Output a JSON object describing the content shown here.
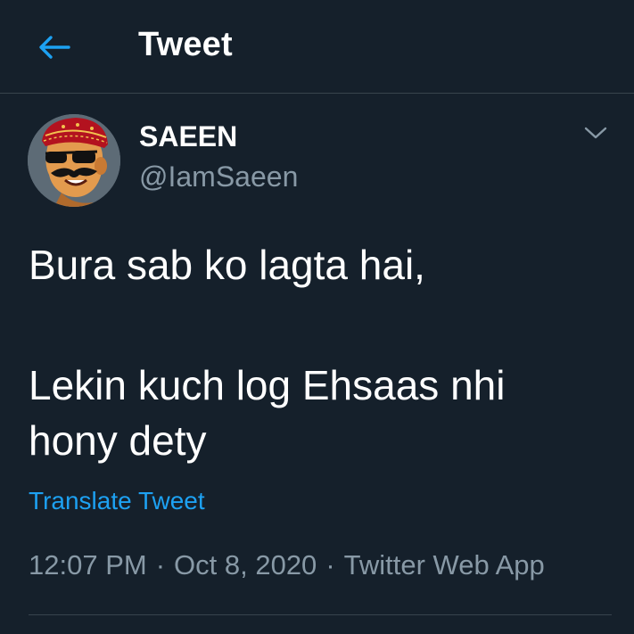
{
  "header": {
    "title": "Tweet",
    "back_icon": "arrow-left-icon"
  },
  "author": {
    "display_name": "SAEEN",
    "handle": "@IamSaeen",
    "menu_icon": "chevron-down-icon"
  },
  "tweet": {
    "lines": [
      "Bura sab ko lagta hai,",
      "Lekin kuch log Ehsaas nhi",
      "hony dety"
    ],
    "translate_label": "Translate Tweet",
    "time": "12:07 PM",
    "date": "Oct 8, 2020",
    "source": "Twitter Web App",
    "separator": "·"
  },
  "colors": {
    "background": "#15202b",
    "accent": "#1da1f2",
    "secondary_text": "#8899a6",
    "border": "#38444d"
  }
}
